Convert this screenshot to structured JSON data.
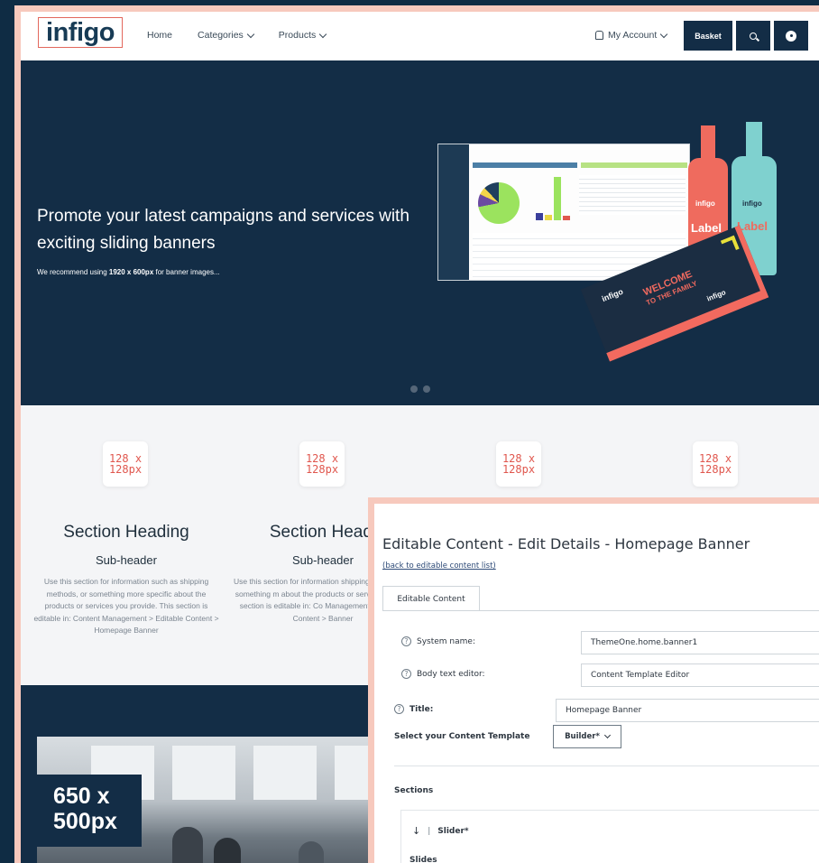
{
  "nav": {
    "logo": "infigo",
    "links": [
      "Home",
      "Categories",
      "Products"
    ],
    "account": "My Account",
    "basket": "Basket"
  },
  "hero": {
    "title": "Promote your latest campaigns and services with exciting sliding banners",
    "sub_prefix": "We recommend using ",
    "sub_bold": "1920 x 600px",
    "sub_suffix": " for banner images...",
    "bottle_label": "Label",
    "bottle_brand": "infigo",
    "box_brand": "infigo",
    "box_welcome_1": "WELCOME",
    "box_welcome_2": "TO THE FAMILY",
    "slide_count": 2
  },
  "features": {
    "placeholder_line1": "128 x",
    "placeholder_line2": "128px",
    "items": [
      {
        "heading": "Section Heading",
        "subheader": "Sub-header",
        "body": "Use this section for information such as shipping methods, or something more specific about the products or services you provide. This section is editable in: Content Management > Editable Content > Homepage Banner"
      },
      {
        "heading": "Section Headi",
        "subheader": "Sub-header",
        "body": "Use this section for information shipping methods, or something m about the products or services yo This section is editable in: Co Management > Editable Content > Banner"
      }
    ]
  },
  "lower": {
    "photo_tag_line1": "650 x",
    "photo_tag_line2": "500px"
  },
  "panel": {
    "title": "Editable Content - Edit Details - Homepage Banner",
    "back_link": "(back to editable content list)",
    "tab": "Editable Content",
    "system_name_label": "System name:",
    "system_name_value": "ThemeOne.home.banner1",
    "body_editor_label": "Body text editor:",
    "body_editor_value": "Content Template Editor",
    "title_label": "Title:",
    "title_value": "Homepage Banner",
    "template_label": "Select your Content Template",
    "template_value": "Builder*",
    "sections_label": "Sections",
    "slider_label": "Slider*",
    "slides_label": "Slides"
  },
  "colors": {
    "navy": "#132d46",
    "accent": "#f26a5f",
    "frame": "#f7c9bd"
  }
}
